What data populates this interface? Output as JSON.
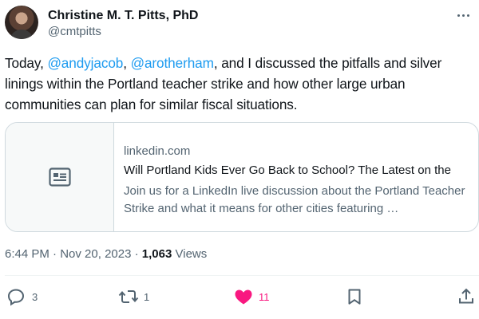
{
  "author": {
    "name": "Christine M. T. Pitts, PhD",
    "handle": "@cmtpitts"
  },
  "tweet": {
    "text_before": "Today, ",
    "mention1": "@andyjacob",
    "text_between": ", ",
    "mention2": "@arotherham",
    "text_after": ", and I discussed the pitfalls and silver linings within the Portland teacher strike and how other large urban communities can plan for similar fiscal situations."
  },
  "link_card": {
    "thumb_icon": "article-icon",
    "domain": "linkedin.com",
    "title": "Will Portland Kids Ever Go Back to School? The Latest on the",
    "description": "Join us for a LinkedIn live discussion about the Portland Teacher Strike and what it means for other cities featuring …"
  },
  "meta": {
    "time": "6:44 PM",
    "separator1": " · ",
    "date": "Nov 20, 2023",
    "separator2": " · ",
    "views_count": "1,063",
    "views_label": " Views"
  },
  "actions": {
    "reply_count": "3",
    "retweet_count": "1",
    "like_count": "11",
    "like_color": "#f91880",
    "accent_color": "#1d9bf0"
  }
}
